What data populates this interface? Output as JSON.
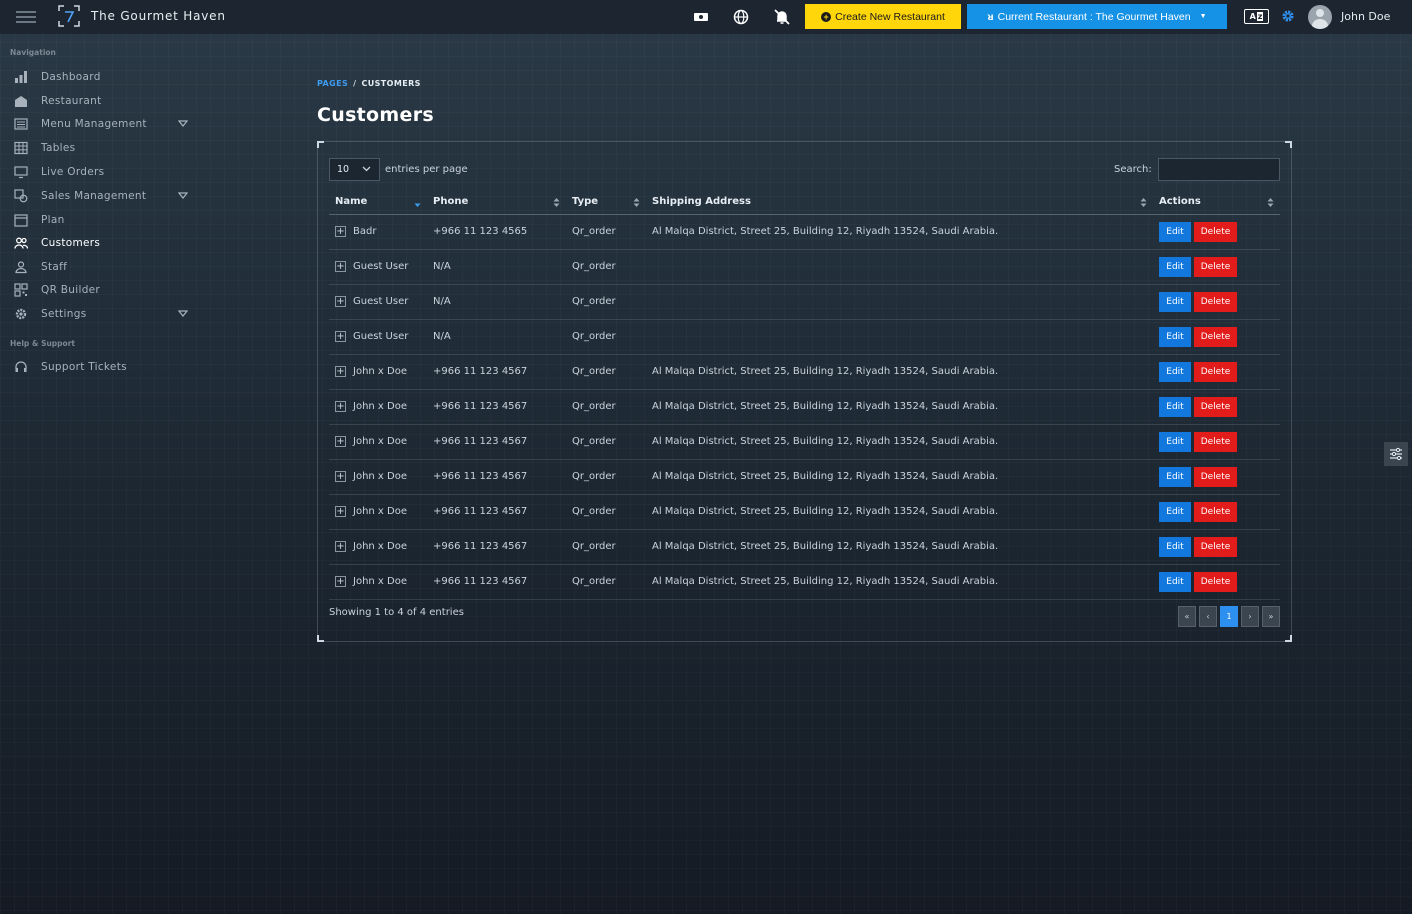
{
  "app": {
    "title": "The Gourmet Haven"
  },
  "topbar": {
    "create_label": "Create New Restaurant",
    "current_label": "Current Restaurant : The Gourmet Haven",
    "lang_badge": "A",
    "user_name": "John Doe"
  },
  "sidebar": {
    "nav_title": "Navigation",
    "help_title": "Help & Support",
    "items": [
      {
        "label": "Dashboard",
        "icon": "bar-chart-icon"
      },
      {
        "label": "Restaurant",
        "icon": "building-icon"
      },
      {
        "label": "Menu Management",
        "icon": "menu-list-icon",
        "expandable": true
      },
      {
        "label": "Tables",
        "icon": "table-grid-icon"
      },
      {
        "label": "Live Orders",
        "icon": "monitor-icon"
      },
      {
        "label": "Sales Management",
        "icon": "sales-icon",
        "expandable": true
      },
      {
        "label": "Plan",
        "icon": "calendar-icon"
      },
      {
        "label": "Customers",
        "icon": "users-icon",
        "active": true
      },
      {
        "label": "Staff",
        "icon": "user-icon"
      },
      {
        "label": "QR Builder",
        "icon": "qr-code-icon"
      },
      {
        "label": "Settings",
        "icon": "gear-icon",
        "expandable": true
      }
    ],
    "help_items": [
      {
        "label": "Support Tickets",
        "icon": "headset-icon"
      }
    ]
  },
  "breadcrumb": {
    "root": "PAGES",
    "separator": "/",
    "current": "CUSTOMERS"
  },
  "page_title": "Customers",
  "table_controls": {
    "entries_value": "10",
    "entries_label": "entries per page",
    "search_label": "Search:",
    "search_value": ""
  },
  "table": {
    "columns": [
      "Name",
      "Phone",
      "Type",
      "Shipping Address",
      "Actions"
    ],
    "edit_label": "Edit",
    "delete_label": "Delete",
    "rows": [
      {
        "name": "Badr",
        "phone": "+966 11 123 4565",
        "type": "Qr_order",
        "address": "Al Malqa District, Street 25, Building 12, Riyadh 13524, Saudi Arabia."
      },
      {
        "name": "Guest User",
        "phone": "N/A",
        "type": "Qr_order",
        "address": ""
      },
      {
        "name": "Guest User",
        "phone": "N/A",
        "type": "Qr_order",
        "address": ""
      },
      {
        "name": "Guest User",
        "phone": "N/A",
        "type": "Qr_order",
        "address": ""
      },
      {
        "name": "John x Doe",
        "phone": "+966 11 123 4567",
        "type": "Qr_order",
        "address": "Al Malqa District, Street 25, Building 12, Riyadh 13524, Saudi Arabia."
      },
      {
        "name": "John x Doe",
        "phone": "+966 11 123 4567",
        "type": "Qr_order",
        "address": "Al Malqa District, Street 25, Building 12, Riyadh 13524, Saudi Arabia."
      },
      {
        "name": "John x Doe",
        "phone": "+966 11 123 4567",
        "type": "Qr_order",
        "address": "Al Malqa District, Street 25, Building 12, Riyadh 13524, Saudi Arabia."
      },
      {
        "name": "John x Doe",
        "phone": "+966 11 123 4567",
        "type": "Qr_order",
        "address": "Al Malqa District, Street 25, Building 12, Riyadh 13524, Saudi Arabia."
      },
      {
        "name": "John x Doe",
        "phone": "+966 11 123 4567",
        "type": "Qr_order",
        "address": "Al Malqa District, Street 25, Building 12, Riyadh 13524, Saudi Arabia."
      },
      {
        "name": "John x Doe",
        "phone": "+966 11 123 4567",
        "type": "Qr_order",
        "address": "Al Malqa District, Street 25, Building 12, Riyadh 13524, Saudi Arabia."
      },
      {
        "name": "John x Doe",
        "phone": "+966 11 123 4567",
        "type": "Qr_order",
        "address": "Al Malqa District, Street 25, Building 12, Riyadh 13524, Saudi Arabia."
      }
    ]
  },
  "footer": {
    "info": "Showing 1 to 4 of 4 entries"
  },
  "pagination": {
    "first": "«",
    "prev": "‹",
    "current": "1",
    "next": "›",
    "last": "»"
  },
  "colors": {
    "accent": "#1592e6",
    "create": "#ffd60a",
    "edit": "#1278dd",
    "delete": "#e21b1b"
  }
}
